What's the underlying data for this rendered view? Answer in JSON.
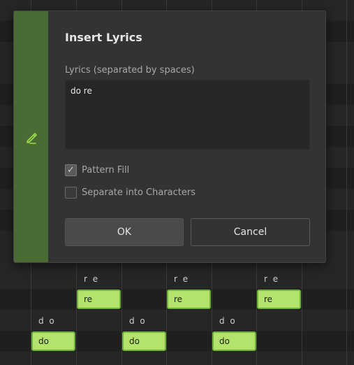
{
  "dialog": {
    "title": "Insert Lyrics",
    "field_label": "Lyrics (separated by spaces)",
    "lyrics_value": "do re",
    "pattern_fill": {
      "label": "Pattern Fill",
      "checked": true
    },
    "separate_chars": {
      "label": "Separate into Characters",
      "checked": false
    },
    "ok_label": "OK",
    "cancel_label": "Cancel",
    "side_icon": "pen-icon",
    "accent_color": "#4a6b34"
  },
  "piano_roll": {
    "upper_notes": [
      {
        "lyric_above": "r e",
        "label": "re"
      },
      {
        "lyric_above": "r e",
        "label": "re"
      },
      {
        "lyric_above": "r e",
        "label": "re"
      }
    ],
    "lower_notes": [
      {
        "lyric_above": "d o",
        "label": "do"
      },
      {
        "lyric_above": "d o",
        "label": "do"
      },
      {
        "lyric_above": "d o",
        "label": "do"
      }
    ],
    "note_color": "#b3e36a",
    "note_border_color": "#6fb33a"
  }
}
